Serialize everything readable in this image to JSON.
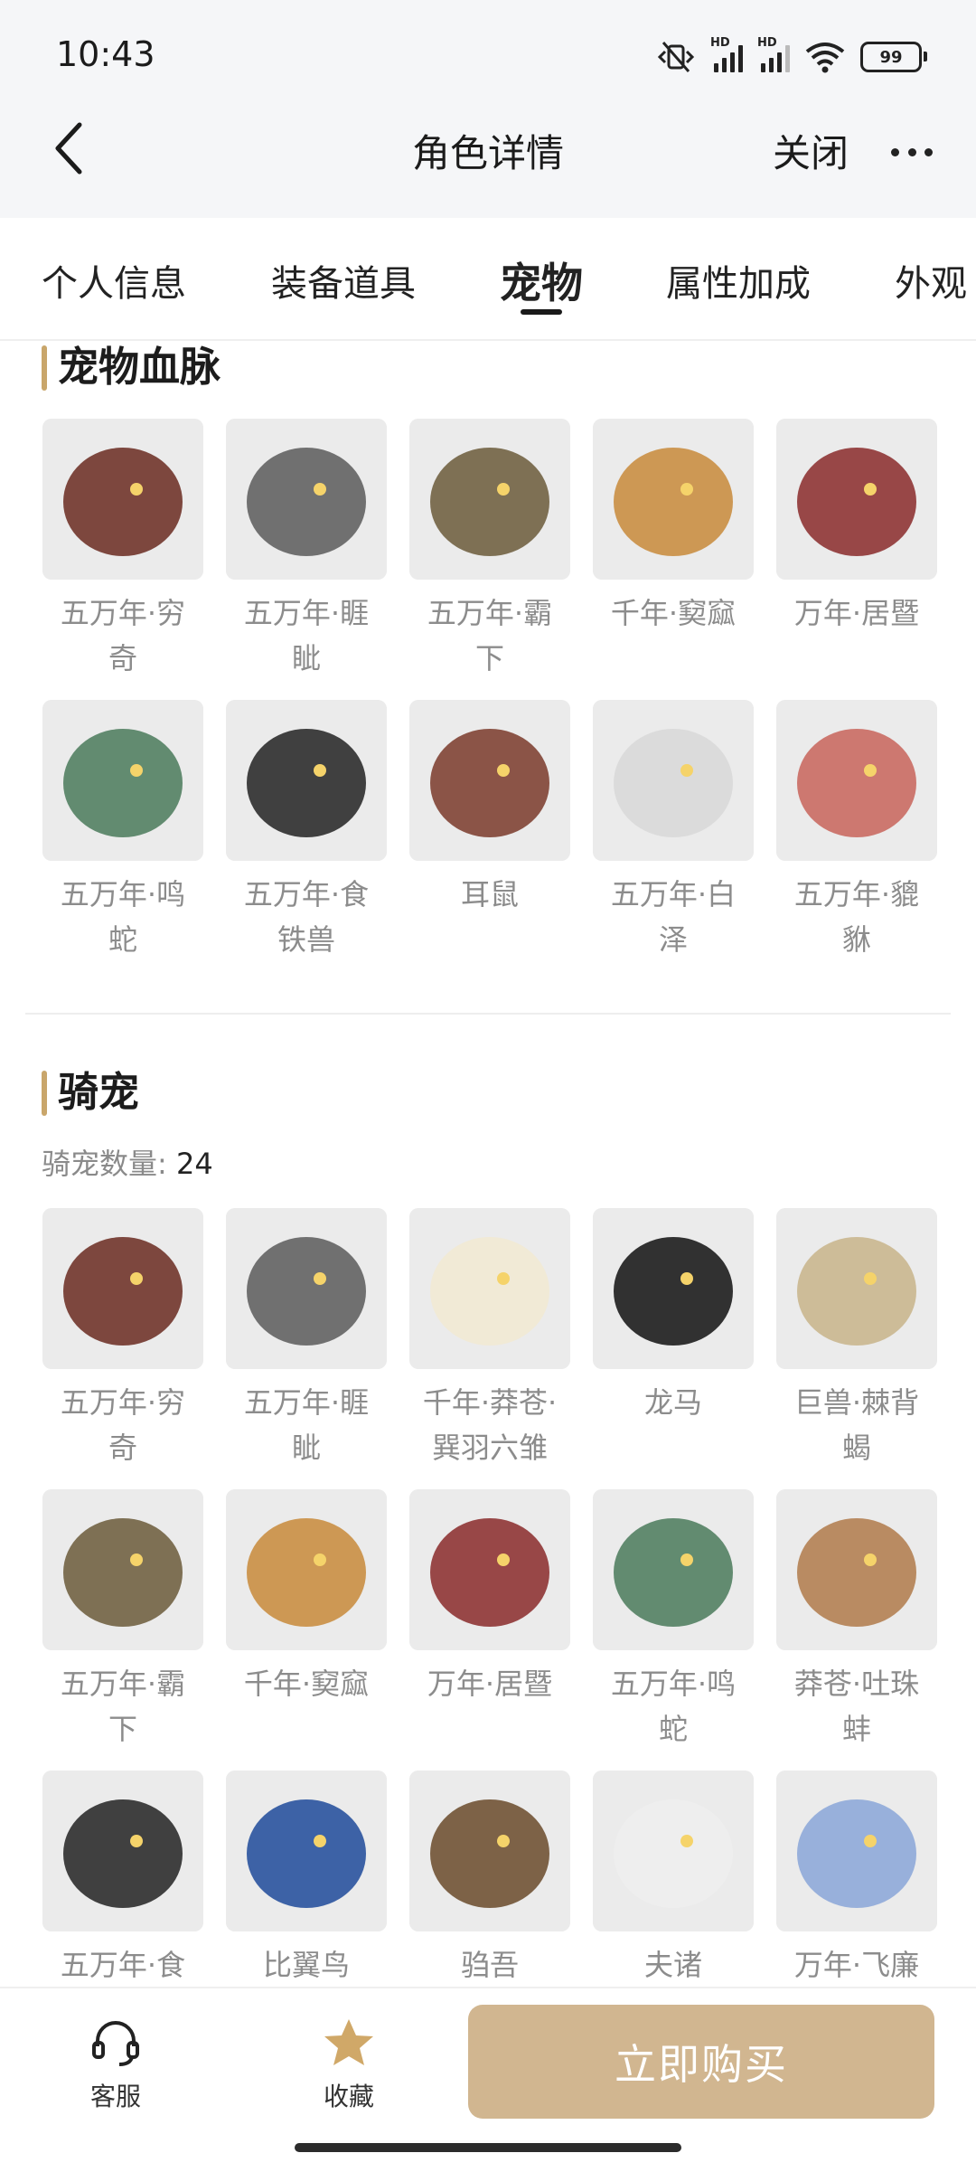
{
  "status_bar": {
    "time": "10:43",
    "battery": "99",
    "hd": "HD"
  },
  "header": {
    "title": "角色详情",
    "close_label": "关闭"
  },
  "tabs": [
    {
      "label": "个人信息"
    },
    {
      "label": "装备道具"
    },
    {
      "label": "宠物",
      "active": true
    },
    {
      "label": "属性加成"
    },
    {
      "label": "外观"
    }
  ],
  "bloodline": {
    "title": "宠物血脉",
    "items": [
      {
        "label": "五万年·穷奇",
        "icon": "pet-qiongqi-icon",
        "color": "#6a2a20"
      },
      {
        "label": "五万年·睚眦",
        "icon": "pet-yazi-icon",
        "color": "#5a5a5a"
      },
      {
        "label": "五万年·霸下",
        "icon": "pet-baxia-icon",
        "color": "#6b5a3a"
      },
      {
        "label": "千年·窫窳",
        "icon": "pet-yayu-icon",
        "color": "#c88a3a"
      },
      {
        "label": "万年·居暨",
        "icon": "pet-juji-icon",
        "color": "#8a2a2a"
      },
      {
        "label": "五万年·鸣蛇",
        "icon": "pet-mingshe-icon",
        "color": "#4a7a5a"
      },
      {
        "label": "五万年·食铁兽",
        "icon": "pet-panda-icon",
        "color": "#222222"
      },
      {
        "label": "耳鼠",
        "icon": "pet-ershu-icon",
        "color": "#7a3a2a"
      },
      {
        "label": "五万年·白泽",
        "icon": "pet-baize-icon",
        "color": "#d8d8d8"
      },
      {
        "label": "五万年·貔貅",
        "icon": "pet-pixiu-icon",
        "color": "#c8645a"
      }
    ]
  },
  "mounts": {
    "title": "骑宠",
    "count_label": "骑宠数量:",
    "count": "24",
    "items": [
      {
        "label": "五万年·穷奇",
        "icon": "mount-qiongqi-icon",
        "color": "#6a2a20"
      },
      {
        "label": "五万年·睚眦",
        "icon": "mount-yazi-icon",
        "color": "#5a5a5a"
      },
      {
        "label": "千年·莽苍·巽羽六雏",
        "icon": "mount-chick-icon",
        "color": "#f2ead2"
      },
      {
        "label": "龙马",
        "icon": "mount-longma-icon",
        "color": "#111111"
      },
      {
        "label": "巨兽·棘背蝎",
        "icon": "mount-scorpion-icon",
        "color": "#c8b48a"
      },
      {
        "label": "五万年·霸下",
        "icon": "mount-baxia-icon",
        "color": "#6b5a3a"
      },
      {
        "label": "千年·窫窳",
        "icon": "mount-yayu-icon",
        "color": "#c88a3a"
      },
      {
        "label": "万年·居暨",
        "icon": "mount-juji-icon",
        "color": "#8a2a2a"
      },
      {
        "label": "五万年·鸣蛇",
        "icon": "mount-mingshe-icon",
        "color": "#4a7a5a"
      },
      {
        "label": "莽苍·吐珠蚌",
        "icon": "mount-clam-icon",
        "color": "#b07a4a"
      },
      {
        "label": "五万年·食",
        "icon": "mount-panda-icon",
        "color": "#222222"
      },
      {
        "label": "比翼鸟",
        "icon": "mount-biyi-icon",
        "color": "#1f4a9a"
      },
      {
        "label": "驺吾",
        "icon": "mount-zouwu-icon",
        "color": "#6a4a2a"
      },
      {
        "label": "夫诸",
        "icon": "mount-fuzhu-icon",
        "color": "#eeeeee"
      },
      {
        "label": "万年·飞廉",
        "icon": "mount-feilian-icon",
        "color": "#8aa6d8"
      }
    ]
  },
  "bottom_bar": {
    "service_label": "客服",
    "favorite_label": "收藏",
    "buy_label": "立即购买"
  },
  "colors": {
    "accent": "#c9a66b",
    "buy_button": "#d1b690",
    "label_gray": "#8c8c8c"
  }
}
